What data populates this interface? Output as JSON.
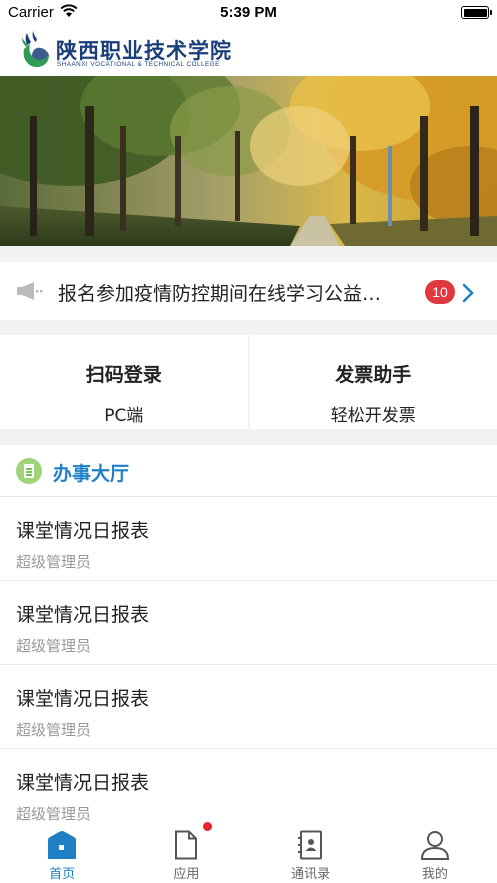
{
  "status_bar": {
    "carrier": "Carrier",
    "time": "5:39 PM"
  },
  "header": {
    "title_cn": "陕西职业技术学院",
    "title_en": "SHAANXI VOCATIONAL & TECHNICAL COLLEGE"
  },
  "notice": {
    "text": "报名参加疫情防控期间在线学习公益…",
    "badge": "10"
  },
  "tiles": [
    {
      "title": "扫码登录",
      "subtitle": "PC端"
    },
    {
      "title": "发票助手",
      "subtitle": "轻松开发票"
    }
  ],
  "hall": {
    "title": "办事大厅",
    "items": [
      {
        "title": "课堂情况日报表",
        "subtitle": "超级管理员"
      },
      {
        "title": "课堂情况日报表",
        "subtitle": "超级管理员"
      },
      {
        "title": "课堂情况日报表",
        "subtitle": "超级管理员"
      },
      {
        "title": "课堂情况日报表",
        "subtitle": "超级管理员"
      }
    ]
  },
  "tabbar": [
    {
      "label": "首页",
      "icon": "home-icon",
      "active": true
    },
    {
      "label": "应用",
      "icon": "document-icon",
      "active": false,
      "badge_dot": true
    },
    {
      "label": "通讯录",
      "icon": "contacts-icon",
      "active": false
    },
    {
      "label": "我的",
      "icon": "person-icon",
      "active": false
    }
  ],
  "colors": {
    "accent": "#1e7fc4",
    "badge": "#e0383e",
    "logo_text": "#1b3f7a",
    "hall_icon": "#9fd47a"
  }
}
